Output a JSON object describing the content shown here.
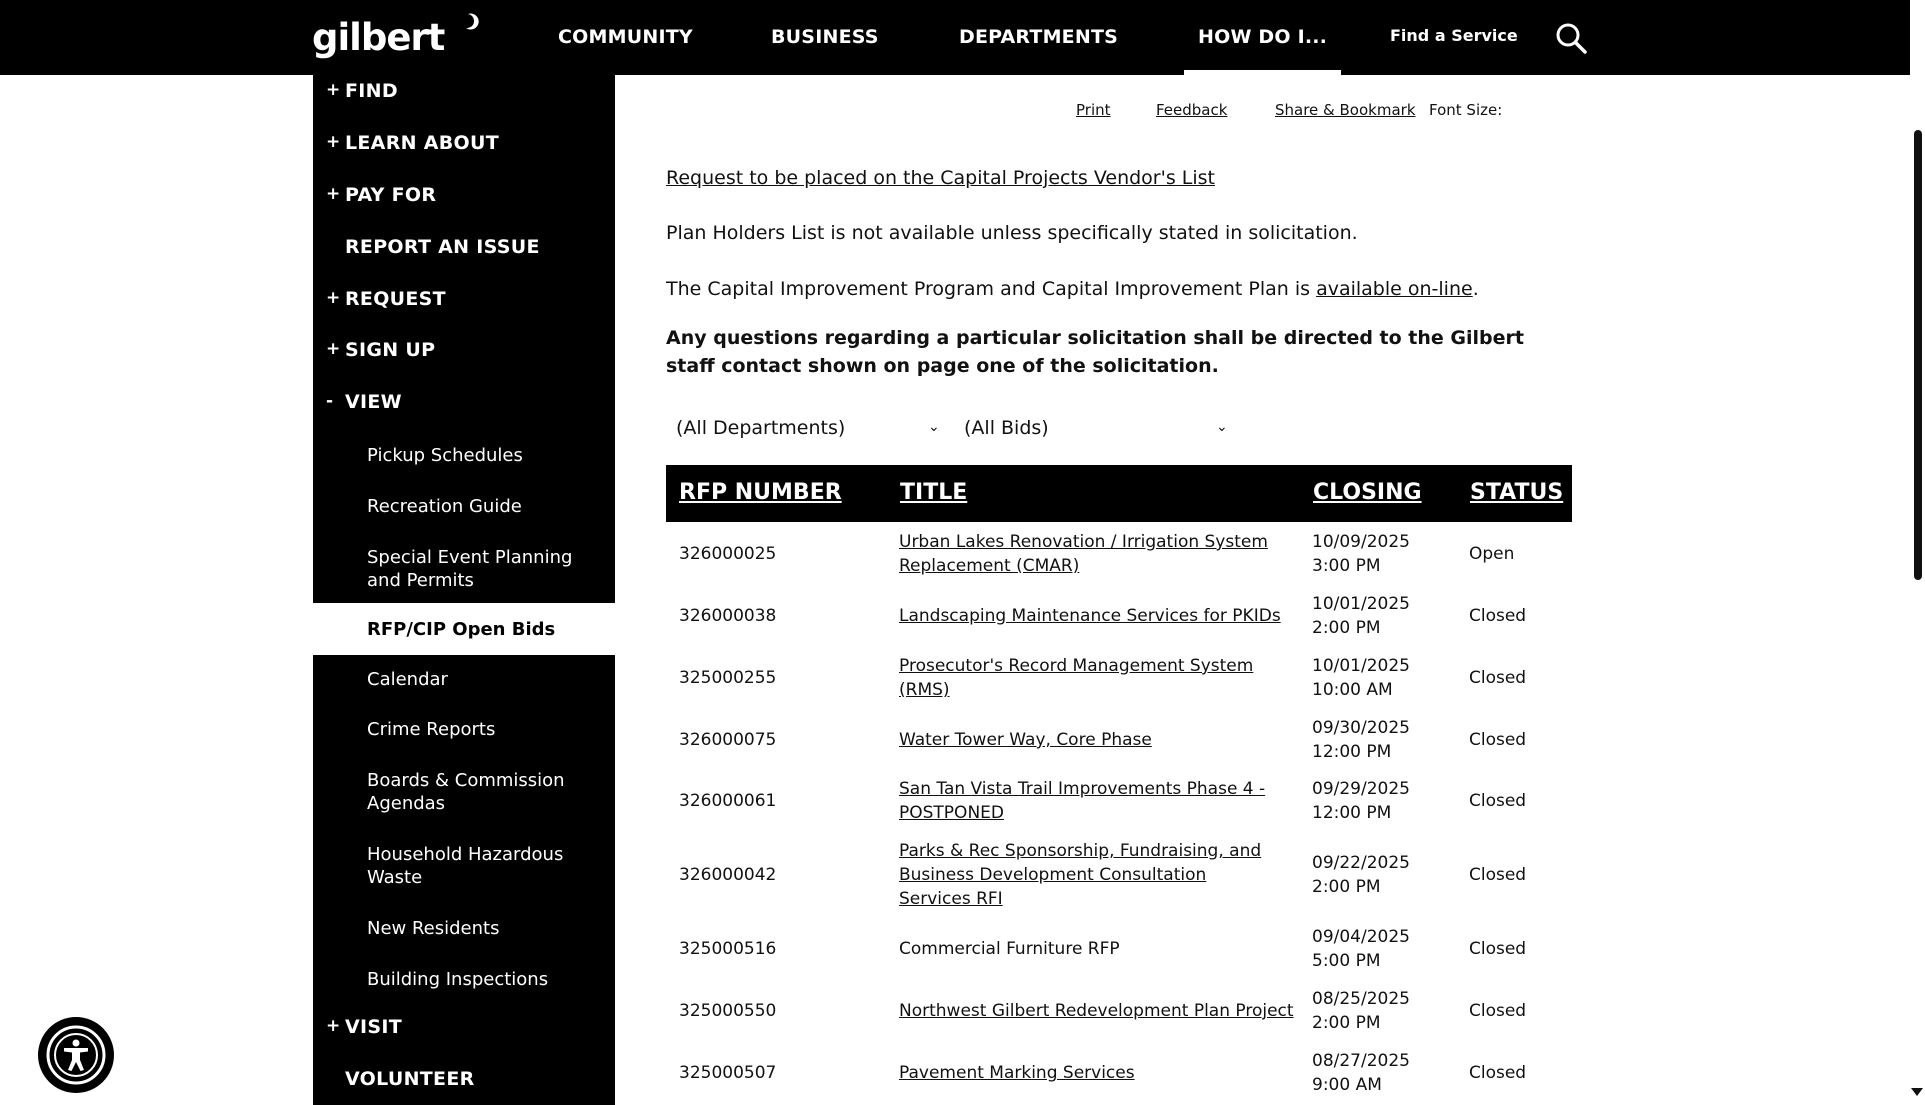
{
  "header": {
    "logo_text": "gilbert",
    "nav": [
      "COMMUNITY",
      "BUSINESS",
      "DEPARTMENTS",
      "HOW DO I..."
    ],
    "find_service": "Find a Service"
  },
  "sidebar": {
    "items": [
      {
        "sign": "+",
        "label": "FIND"
      },
      {
        "sign": "+",
        "label": "LEARN ABOUT"
      },
      {
        "sign": "+",
        "label": "PAY FOR"
      },
      {
        "sign": "",
        "label": "REPORT AN ISSUE"
      },
      {
        "sign": "+",
        "label": "REQUEST"
      },
      {
        "sign": "+",
        "label": "SIGN UP"
      },
      {
        "sign": "-",
        "label": "VIEW"
      }
    ],
    "view_children": [
      "Pickup Schedules",
      "Recreation Guide",
      "Special Event Planning and Permits",
      "RFP/CIP Open Bids",
      "Calendar",
      "Crime Reports",
      "Boards & Commission Agendas",
      "Household Hazardous Waste",
      "New Residents",
      "Building Inspections"
    ],
    "bottom_items": [
      {
        "sign": "+",
        "label": "VISIT"
      },
      {
        "sign": "",
        "label": "VOLUNTEER"
      }
    ]
  },
  "utility": {
    "print": "Print",
    "feedback": "Feedback",
    "share": "Share & Bookmark",
    "font_size": "Font Size:"
  },
  "content": {
    "vendor_link": "Request to be placed on the Capital Projects Vendor's List",
    "plan_holders": "Plan Holders List is not available unless specifically stated in solicitation.",
    "cip_text": "The Capital Improvement Program and Capital Improvement Plan is ",
    "cip_link": "available on-line",
    "cip_end": ".",
    "questions": "Any questions regarding a particular solicitation shall be directed to the Gilbert staff contact shown on page one of the solicitation."
  },
  "filters": {
    "department": "(All Departments)",
    "bids": "(All Bids)"
  },
  "table": {
    "headers": [
      "RFP NUMBER",
      "TITLE",
      "CLOSING",
      "STATUS"
    ],
    "rows": [
      {
        "number": "326000025",
        "title": "Urban Lakes Renovation / Irrigation System Replacement (CMAR)",
        "date": "10/09/2025",
        "time": "3:00 PM",
        "status": "Open"
      },
      {
        "number": "326000038",
        "title": "Landscaping Maintenance Services for PKIDs",
        "date": "10/01/2025",
        "time": "2:00 PM",
        "status": "Closed"
      },
      {
        "number": "325000255",
        "title": "Prosecutor's Record Management System (RMS)",
        "date": "10/01/2025",
        "time": "10:00 AM",
        "status": "Closed"
      },
      {
        "number": "326000075",
        "title": "Water Tower Way, Core Phase",
        "date": "09/30/2025",
        "time": "12:00 PM",
        "status": "Closed"
      },
      {
        "number": "326000061",
        "title": "San Tan Vista Trail Improvements Phase 4 - POSTPONED",
        "date": "09/29/2025",
        "time": "12:00 PM",
        "status": "Closed"
      },
      {
        "number": "326000042",
        "title": "Parks & Rec Sponsorship, Fundraising, and Business Development Consultation Services RFI",
        "date": "09/22/2025",
        "time": "2:00 PM",
        "status": "Closed"
      },
      {
        "number": "325000516",
        "title": "Commercial Furniture RFP",
        "date": "09/04/2025",
        "time": "5:00 PM",
        "status": "Closed"
      },
      {
        "number": "325000550",
        "title": "Northwest Gilbert Redevelopment Plan Project",
        "date": "08/25/2025",
        "time": "2:00 PM",
        "status": "Closed"
      },
      {
        "number": "325000507",
        "title": "Pavement Marking Services",
        "date": "08/27/2025",
        "time": "9:00 AM",
        "status": "Closed"
      }
    ]
  }
}
